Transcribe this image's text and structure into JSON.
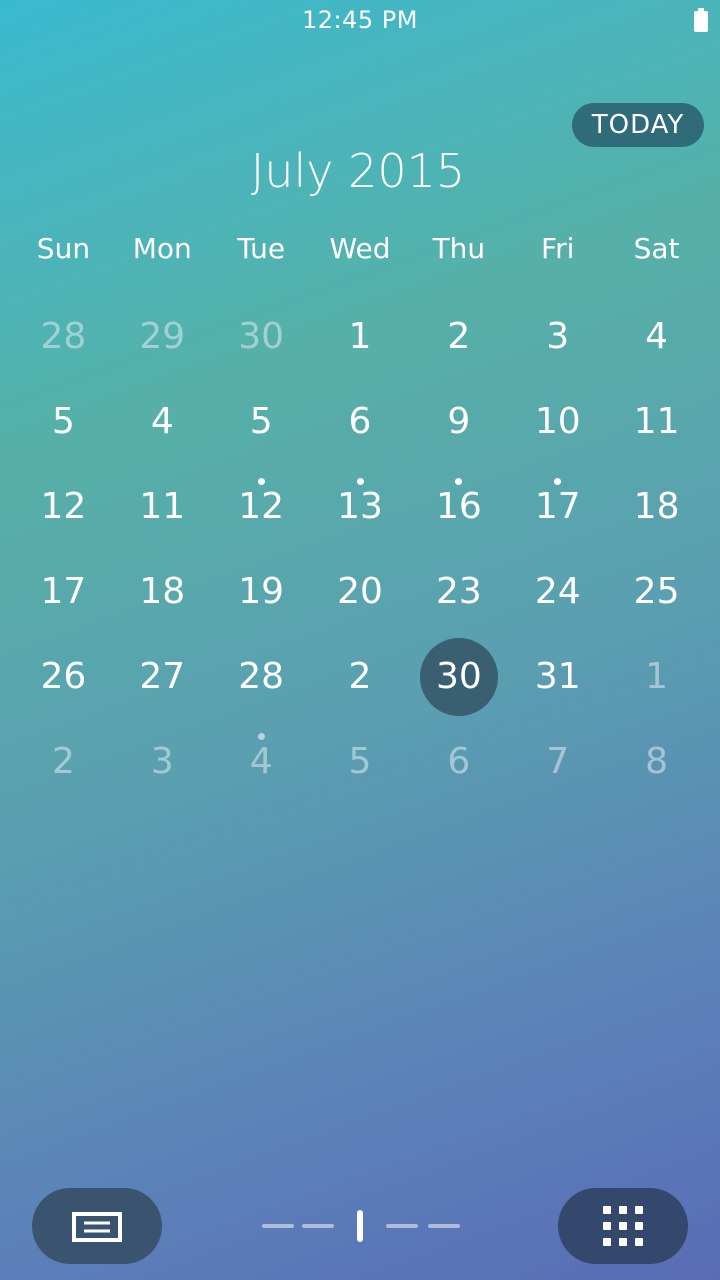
{
  "status_bar": {
    "time": "12:45 PM",
    "battery_icon": "battery-full-icon"
  },
  "header": {
    "today_label": "TODAY",
    "month_title": "July 2015"
  },
  "weekdays": [
    "Sun",
    "Mon",
    "Tue",
    "Wed",
    "Thu",
    "Fri",
    "Sat"
  ],
  "weeks": [
    [
      {
        "d": "28",
        "m": true
      },
      {
        "d": "29",
        "m": true
      },
      {
        "d": "30",
        "m": true
      },
      {
        "d": "1"
      },
      {
        "d": "2"
      },
      {
        "d": "3"
      },
      {
        "d": "4"
      }
    ],
    [
      {
        "d": "5"
      },
      {
        "d": "4"
      },
      {
        "d": "5"
      },
      {
        "d": "6"
      },
      {
        "d": "9"
      },
      {
        "d": "10"
      },
      {
        "d": "11"
      }
    ],
    [
      {
        "d": "12"
      },
      {
        "d": "11"
      },
      {
        "d": "12",
        "e": true
      },
      {
        "d": "13",
        "e": true
      },
      {
        "d": "16",
        "e": true
      },
      {
        "d": "17",
        "e": true
      },
      {
        "d": "18"
      }
    ],
    [
      {
        "d": "17"
      },
      {
        "d": "18"
      },
      {
        "d": "19"
      },
      {
        "d": "20"
      },
      {
        "d": "23"
      },
      {
        "d": "24"
      },
      {
        "d": "25"
      }
    ],
    [
      {
        "d": "26"
      },
      {
        "d": "27"
      },
      {
        "d": "28"
      },
      {
        "d": "2"
      },
      {
        "d": "30",
        "s": true
      },
      {
        "d": "31"
      },
      {
        "d": "1",
        "m": true
      }
    ],
    [
      {
        "d": "2",
        "m": true
      },
      {
        "d": "3",
        "m": true
      },
      {
        "d": "4",
        "m": true,
        "e": true
      },
      {
        "d": "5",
        "m": true
      },
      {
        "d": "6",
        "m": true
      },
      {
        "d": "7",
        "m": true
      },
      {
        "d": "8",
        "m": true
      }
    ]
  ],
  "bottom_bar": {
    "left_icon": "list-view-icon",
    "right_icon": "app-grid-icon",
    "page_indicator": {
      "pages": 5,
      "current": 3
    }
  }
}
